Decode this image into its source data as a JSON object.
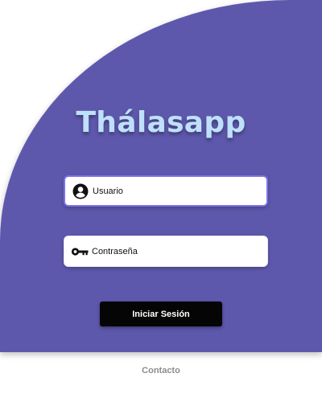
{
  "app": {
    "title": "Thálasapp"
  },
  "form": {
    "username": {
      "placeholder": "Usuario",
      "value": "",
      "icon": "user-circle-icon"
    },
    "password": {
      "placeholder": "Contraseña",
      "value": "",
      "icon": "key-icon"
    },
    "submit_label": "Iniciar Sesión"
  },
  "footer": {
    "contact_label": "Contacto"
  },
  "colors": {
    "background": "#5e58ad",
    "title": "#bfe0fb",
    "focus_border": "#7b73e6",
    "button": "#050505",
    "footer_text": "#8c8c8c"
  }
}
